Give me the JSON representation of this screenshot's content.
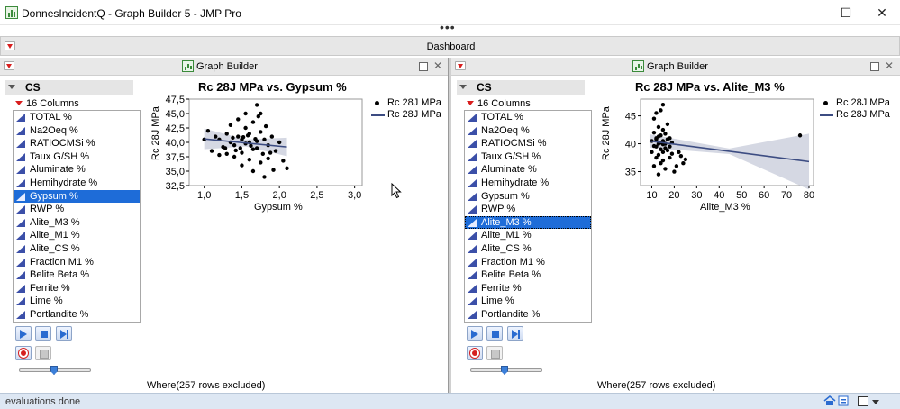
{
  "window": {
    "title": "DonnesIncidentQ - Graph Builder 5 - JMP Pro",
    "minimize": "—",
    "maximize": "☐",
    "close": "✕"
  },
  "dashboard": {
    "title": "Dashboard"
  },
  "status": {
    "text": "evaluations done"
  },
  "panels": [
    {
      "header": "Graph Builder",
      "table_name": "CS",
      "columns_count": "16 Columns",
      "columns": [
        "TOTAL %",
        "Na2Oeq %",
        "RATIOCMSi %",
        "Taux G/SH %",
        "Aluminate %",
        "Hemihydrate %",
        "Gypsum %",
        "RWP %",
        "Alite_M3 %",
        "Alite_M1 %",
        "Alite_CS %",
        "Fraction M1 %",
        "Belite Beta %",
        "Ferrite %",
        "Lime %",
        "Portlandite %"
      ],
      "selected_column": "Gypsum %",
      "where_text": "Where(257 rows excluded)",
      "legend": {
        "points_label": "Rc 28J MPa",
        "line_label": "Rc 28J MPa"
      },
      "chart_data": {
        "type": "scatter",
        "title": "Rc 28J MPa vs. Gypsum %",
        "xlabel": "Gypsum %",
        "ylabel": "Rc 28J MPa",
        "xlim": [
          0.8,
          3.1
        ],
        "ylim": [
          32.5,
          47.5
        ],
        "xticks": [
          "1,0",
          "1,5",
          "2,0",
          "2,5",
          "3,0"
        ],
        "yticks": [
          "32,5",
          "35,0",
          "37,5",
          "40,0",
          "42,5",
          "45,0",
          "47,5"
        ],
        "fit_line": {
          "x": [
            1.0,
            2.1
          ],
          "y": [
            40.6,
            39.2
          ]
        },
        "points": [
          [
            1.0,
            40.5
          ],
          [
            1.05,
            42.0
          ],
          [
            1.1,
            38.5
          ],
          [
            1.15,
            41.0
          ],
          [
            1.2,
            37.8
          ],
          [
            1.2,
            40.5
          ],
          [
            1.25,
            39.2
          ],
          [
            1.3,
            38.0
          ],
          [
            1.3,
            41.5
          ],
          [
            1.35,
            40.0
          ],
          [
            1.35,
            43.0
          ],
          [
            1.4,
            39.5
          ],
          [
            1.4,
            37.5
          ],
          [
            1.45,
            41.0
          ],
          [
            1.45,
            44.0
          ],
          [
            1.5,
            40.5
          ],
          [
            1.5,
            38.2
          ],
          [
            1.5,
            36.0
          ],
          [
            1.55,
            42.5
          ],
          [
            1.55,
            39.8
          ],
          [
            1.55,
            45.0
          ],
          [
            1.6,
            40.0
          ],
          [
            1.6,
            37.0
          ],
          [
            1.6,
            41.5
          ],
          [
            1.65,
            38.8
          ],
          [
            1.65,
            43.5
          ],
          [
            1.65,
            35.0
          ],
          [
            1.7,
            40.2
          ],
          [
            1.7,
            39.0
          ],
          [
            1.7,
            46.5
          ],
          [
            1.72,
            44.5
          ],
          [
            1.75,
            36.5
          ],
          [
            1.75,
            41.8
          ],
          [
            1.78,
            38.0
          ],
          [
            1.8,
            40.5
          ],
          [
            1.8,
            34.0
          ],
          [
            1.82,
            42.8
          ],
          [
            1.85,
            39.5
          ],
          [
            1.85,
            37.2
          ],
          [
            1.9,
            41.0
          ],
          [
            1.92,
            35.2
          ],
          [
            1.95,
            38.5
          ],
          [
            2.0,
            40.0
          ],
          [
            2.05,
            36.8
          ],
          [
            2.1,
            35.5
          ],
          [
            1.28,
            39.0
          ],
          [
            1.38,
            40.8
          ],
          [
            1.48,
            39.0
          ],
          [
            1.58,
            41.2
          ],
          [
            1.68,
            40.6
          ],
          [
            1.42,
            38.6
          ],
          [
            1.52,
            40.9
          ],
          [
            1.62,
            39.4
          ],
          [
            1.75,
            45.0
          ],
          [
            1.88,
            38.2
          ]
        ]
      }
    },
    {
      "header": "Graph Builder",
      "table_name": "CS",
      "columns_count": "16 Columns",
      "columns": [
        "TOTAL %",
        "Na2Oeq %",
        "RATIOCMSi %",
        "Taux G/SH %",
        "Aluminate %",
        "Hemihydrate %",
        "Gypsum %",
        "RWP %",
        "Alite_M3 %",
        "Alite_M1 %",
        "Alite_CS %",
        "Fraction M1 %",
        "Belite Beta %",
        "Ferrite %",
        "Lime %",
        "Portlandite %"
      ],
      "selected_column": "Alite_M3 %",
      "where_text": "Where(257 rows excluded)",
      "legend": {
        "points_label": "Rc 28J MPa",
        "line_label": "Rc 28J MPa"
      },
      "chart_data": {
        "type": "scatter",
        "title": "Rc 28J MPa vs. Alite_M3 %",
        "xlabel": "Alite_M3 %",
        "ylabel": "Rc 28J MPa",
        "xlim": [
          5,
          82
        ],
        "ylim": [
          32.5,
          48
        ],
        "xticks": [
          "10",
          "20",
          "30",
          "40",
          "50",
          "60",
          "70",
          "80"
        ],
        "yticks": [
          "35",
          "40",
          "45"
        ],
        "fit_line": {
          "x": [
            9,
            80
          ],
          "y": [
            40.5,
            36.8
          ]
        },
        "points": [
          [
            10,
            40.5
          ],
          [
            10,
            38.5
          ],
          [
            11,
            42.0
          ],
          [
            11,
            36.0
          ],
          [
            11,
            44.5
          ],
          [
            12,
            39.5
          ],
          [
            12,
            41.0
          ],
          [
            12,
            37.5
          ],
          [
            12,
            45.5
          ],
          [
            13,
            40.0
          ],
          [
            13,
            38.0
          ],
          [
            13,
            43.0
          ],
          [
            13,
            34.5
          ],
          [
            14,
            41.5
          ],
          [
            14,
            39.0
          ],
          [
            14,
            36.5
          ],
          [
            14,
            46.0
          ],
          [
            15,
            40.5
          ],
          [
            15,
            38.5
          ],
          [
            15,
            42.5
          ],
          [
            15,
            37.0
          ],
          [
            15,
            47.0
          ],
          [
            16,
            40.0
          ],
          [
            16,
            39.2
          ],
          [
            16,
            41.8
          ],
          [
            16,
            35.5
          ],
          [
            17,
            40.8
          ],
          [
            17,
            38.8
          ],
          [
            17,
            43.5
          ],
          [
            18,
            39.5
          ],
          [
            18,
            41.0
          ],
          [
            18,
            37.5
          ],
          [
            19,
            40.2
          ],
          [
            19,
            38.2
          ],
          [
            20,
            35.0
          ],
          [
            21,
            36.0
          ],
          [
            22,
            38.5
          ],
          [
            23,
            37.8
          ],
          [
            24,
            36.5
          ],
          [
            25,
            37.2
          ],
          [
            76,
            41.5
          ],
          [
            12,
            40.8
          ],
          [
            13,
            41.3
          ],
          [
            14,
            40.2
          ],
          [
            11,
            39.6
          ],
          [
            15,
            39.9
          ]
        ]
      }
    }
  ]
}
